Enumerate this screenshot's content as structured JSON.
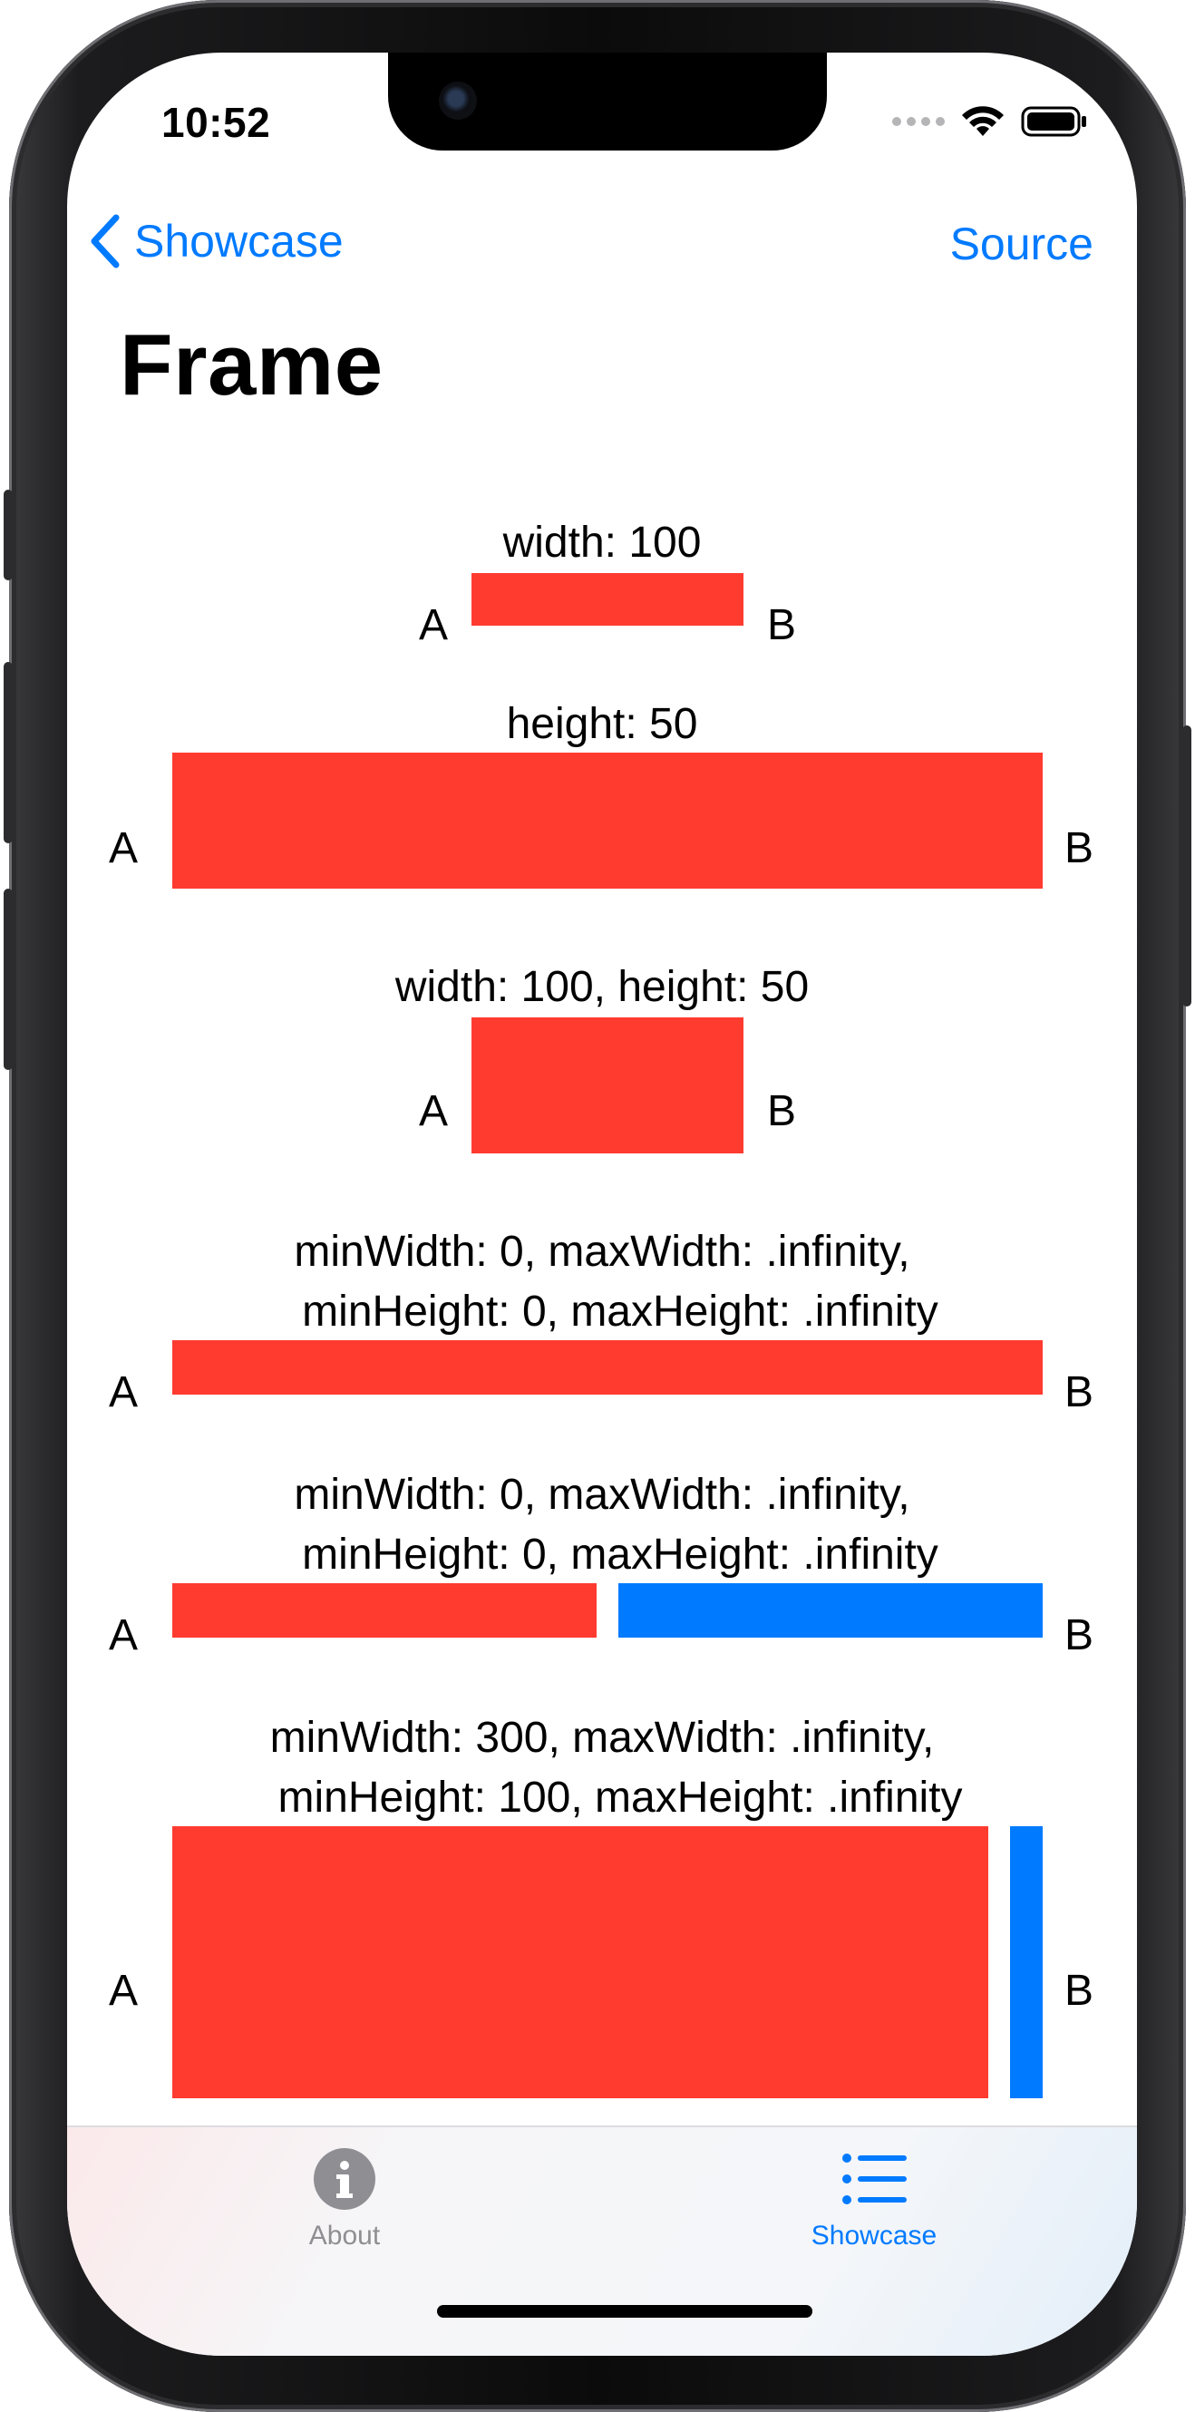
{
  "status_bar": {
    "time": "10:52"
  },
  "nav": {
    "back_label": "Showcase",
    "right_label": "Source",
    "title": "Frame"
  },
  "examples": [
    {
      "caption": "width: 100",
      "left_label": "A",
      "right_label": "B"
    },
    {
      "caption": "height: 50",
      "left_label": "A",
      "right_label": "B"
    },
    {
      "caption": "width: 100, height: 50",
      "left_label": "A",
      "right_label": "B"
    },
    {
      "caption": "minWidth: 0, maxWidth: .infinity,\n   minHeight: 0, maxHeight: .infinity",
      "left_label": "A",
      "right_label": "B"
    },
    {
      "caption": "minWidth: 0, maxWidth: .infinity,\n   minHeight: 0, maxHeight: .infinity",
      "left_label": "A",
      "right_label": "B"
    },
    {
      "caption": "minWidth: 300, maxWidth: .infinity,\n   minHeight: 100, maxHeight: .infinity",
      "left_label": "A",
      "right_label": "B"
    }
  ],
  "colors": {
    "red": "#ff3b30",
    "blue": "#007aff",
    "tint": "#007aff",
    "inactive": "#8e8e93"
  },
  "tab_bar": {
    "tabs": [
      {
        "label": "About",
        "icon": "info-circle-icon",
        "selected": false
      },
      {
        "label": "Showcase",
        "icon": "list-bullet-icon",
        "selected": true
      }
    ]
  }
}
